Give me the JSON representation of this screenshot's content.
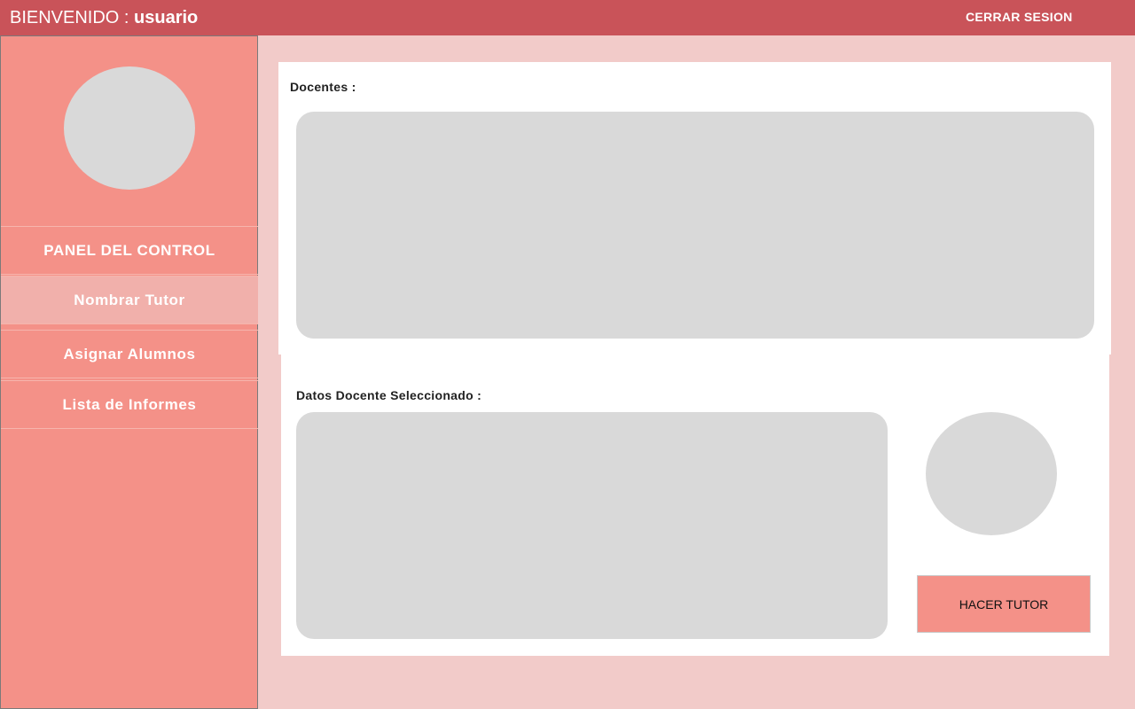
{
  "header": {
    "welcome_label": "BIENVENIDO : ",
    "username": "usuario",
    "logout_label": "CERRAR SESION"
  },
  "sidebar": {
    "items": [
      {
        "label": "PANEL DEL CONTROL"
      },
      {
        "label": "Nombrar Tutor",
        "active": true
      },
      {
        "label": "Asignar Alumnos"
      },
      {
        "label": "Lista de Informes"
      }
    ]
  },
  "main": {
    "docentes_label": "Docentes :",
    "selected_label": "Datos Docente Seleccionado :",
    "make_tutor_label": "HACER TUTOR"
  },
  "colors": {
    "topbar": "#c95359",
    "sidebar": "#f49188",
    "sidebar_active": "#f1b0ab",
    "background": "#f2cbc9",
    "placeholder": "#d9d9d9"
  }
}
